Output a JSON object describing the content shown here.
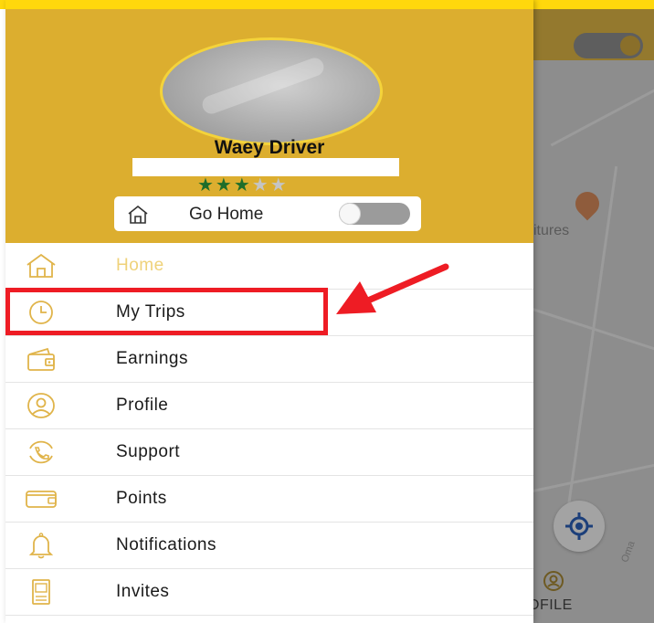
{
  "colors": {
    "header_bg": "#dcae2f",
    "top_strip": "#ffd80c",
    "accent_icon": "#e0b44a",
    "active_label": "#efd27a",
    "star_filled": "#1e6d2a",
    "star_empty": "#c4c4c4",
    "annotation_red": "#ee1c24"
  },
  "profile": {
    "name": "Waey Driver",
    "rating": 3,
    "rating_max": 5,
    "stars": {
      "filled": "★★★",
      "empty": "★★"
    }
  },
  "go_home": {
    "icon": "home-icon",
    "label": "Go Home",
    "enabled": false
  },
  "menu": {
    "items": [
      {
        "label": "Home",
        "icon": "home-icon",
        "active": true
      },
      {
        "label": "My Trips",
        "icon": "clock-icon",
        "active": false
      },
      {
        "label": "Earnings",
        "icon": "wallet-icon",
        "active": false
      },
      {
        "label": "Profile",
        "icon": "user-icon",
        "active": false
      },
      {
        "label": "Support",
        "icon": "phone-icon",
        "active": false
      },
      {
        "label": "Points",
        "icon": "card-icon",
        "active": false
      },
      {
        "label": "Notifications",
        "icon": "bell-icon",
        "active": false
      },
      {
        "label": "Invites",
        "icon": "invite-icon",
        "active": false
      }
    ]
  },
  "annotation": {
    "highlighted_item": "My Trips",
    "arrow_icon": "arrow-icon"
  },
  "map": {
    "poi_label": "itures",
    "street_label": "Oma",
    "bottom_nav_label": "OFILE",
    "locate_icon": "locate-icon"
  }
}
